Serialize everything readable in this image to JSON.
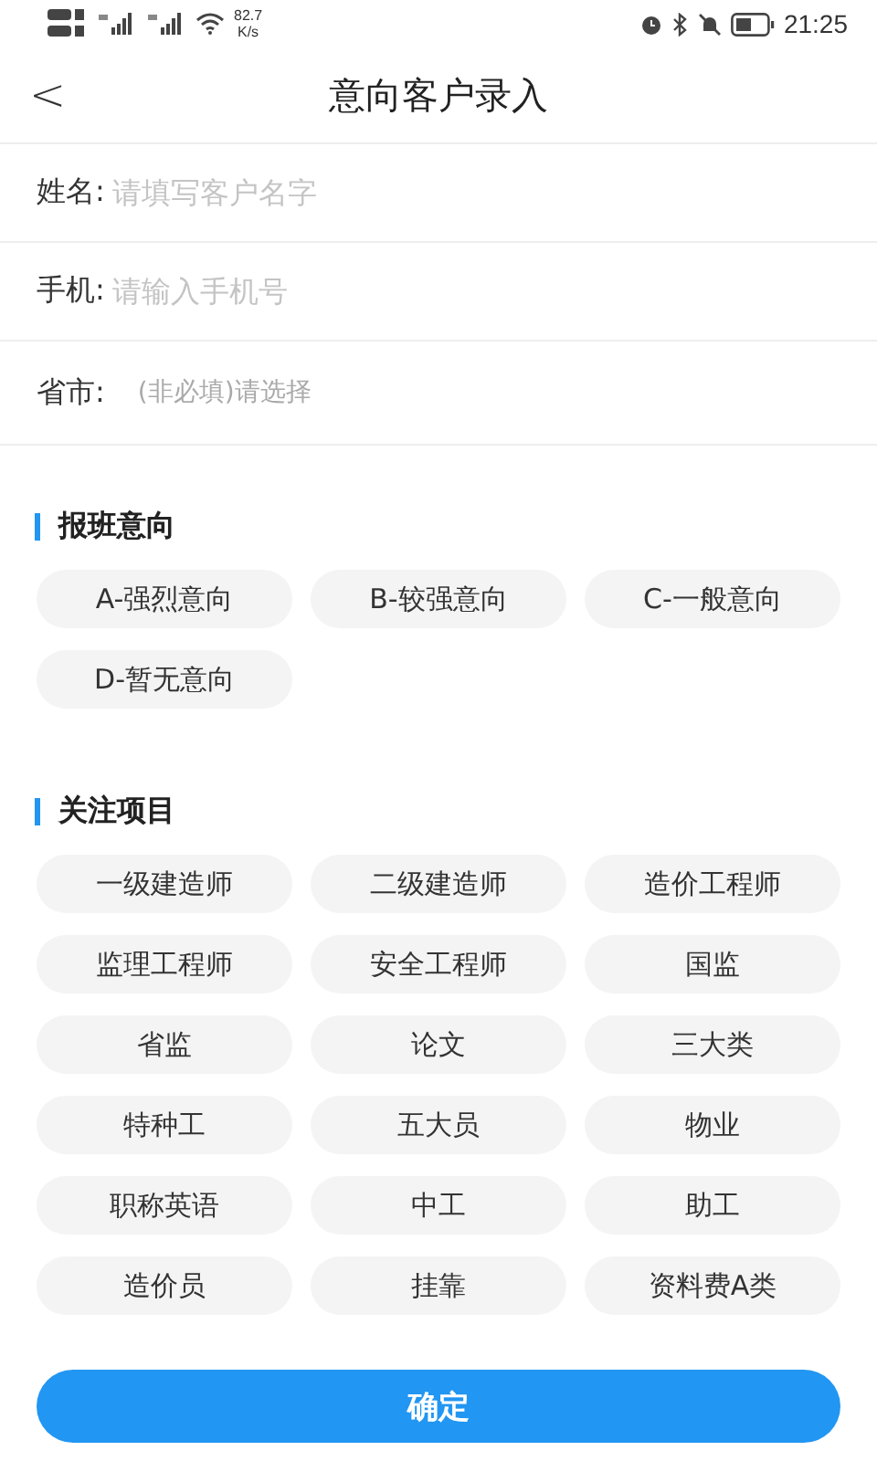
{
  "status_bar": {
    "speed": "82.7",
    "speed_unit": "K/s",
    "time": "21:25"
  },
  "header": {
    "back": "<",
    "title": "意向客户录入"
  },
  "form": [
    {
      "label": "姓名:",
      "placeholder": "请填写客户名字",
      "kind": "text"
    },
    {
      "label": "手机:",
      "placeholder": "请输入手机号",
      "kind": "text"
    },
    {
      "label": "省市:",
      "placeholder": "(非必填)请选择",
      "kind": "picker"
    }
  ],
  "sections": [
    {
      "title": "报班意向",
      "options": [
        {
          "label": "A-强烈意向",
          "selected": false
        },
        {
          "label": "B-较强意向",
          "selected": false
        },
        {
          "label": "C-一般意向",
          "selected": false
        },
        {
          "label": "D-暂无意向",
          "selected": false
        }
      ]
    },
    {
      "title": "关注项目",
      "options": [
        {
          "label": "一级建造师",
          "selected": false
        },
        {
          "label": "二级建造师",
          "selected": false
        },
        {
          "label": "造价工程师",
          "selected": false
        },
        {
          "label": "监理工程师",
          "selected": false
        },
        {
          "label": "安全工程师",
          "selected": false
        },
        {
          "label": "国监",
          "selected": false
        },
        {
          "label": "省监",
          "selected": false
        },
        {
          "label": "论文",
          "selected": false
        },
        {
          "label": "三大类",
          "selected": false
        },
        {
          "label": "特种工",
          "selected": false
        },
        {
          "label": "五大员",
          "selected": false
        },
        {
          "label": "物业",
          "selected": false
        },
        {
          "label": "职称英语",
          "selected": false
        },
        {
          "label": "中工",
          "selected": false
        },
        {
          "label": "助工",
          "selected": false
        },
        {
          "label": "造价员",
          "selected": false
        },
        {
          "label": "挂靠",
          "selected": false
        },
        {
          "label": "资料费A类",
          "selected": false
        }
      ]
    }
  ],
  "submit": "确定"
}
